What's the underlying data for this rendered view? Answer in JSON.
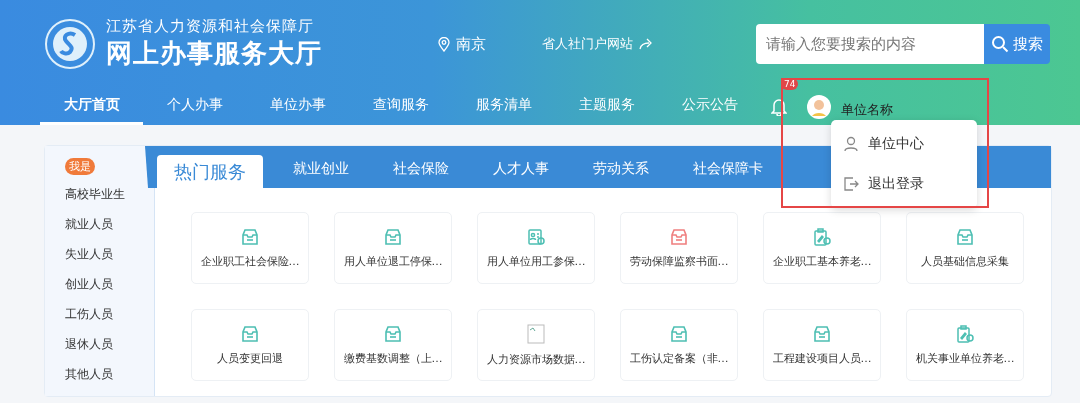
{
  "header": {
    "org_name": "江苏省人力资源和社会保障厅",
    "site_title": "网上办事服务大厅",
    "city": "南京",
    "portal_link": "省人社门户网站",
    "search": {
      "placeholder": "请输入您要搜索的内容",
      "button": "搜索"
    }
  },
  "nav": [
    {
      "label": "大厅首页",
      "selected": true
    },
    {
      "label": "个人办事",
      "selected": false
    },
    {
      "label": "单位办事",
      "selected": false
    },
    {
      "label": "查询服务",
      "selected": false
    },
    {
      "label": "服务清单",
      "selected": false
    },
    {
      "label": "主题服务",
      "selected": false
    },
    {
      "label": "公示公告",
      "selected": false
    }
  ],
  "notifications": {
    "count": "74"
  },
  "user": {
    "name": "单位名称",
    "menu": [
      {
        "kind": "user",
        "label": "单位中心"
      },
      {
        "kind": "logout",
        "label": "退出登录"
      }
    ]
  },
  "sidebar": {
    "badge": "我是",
    "items": [
      "高校毕业生",
      "就业人员",
      "失业人员",
      "创业人员",
      "工伤人员",
      "退休人员",
      "其他人员"
    ]
  },
  "tabs": [
    {
      "label": "热门服务",
      "selected": true
    },
    {
      "label": "就业创业",
      "selected": false
    },
    {
      "label": "社会保险",
      "selected": false
    },
    {
      "label": "人才人事",
      "selected": false
    },
    {
      "label": "劳动关系",
      "selected": false
    },
    {
      "label": "社会保障卡",
      "selected": false
    }
  ],
  "services": [
    {
      "kind": "tray",
      "label": "企业职工社会保险…"
    },
    {
      "kind": "tray",
      "label": "用人单位退工停保…"
    },
    {
      "kind": "certificate",
      "label": "用人单位用工参保…"
    },
    {
      "kind": "alert-tray",
      "label": "劳动保障监察书面…"
    },
    {
      "kind": "clipboard",
      "label": "企业职工基本养老…"
    },
    {
      "kind": "tray",
      "label": "人员基础信息采集"
    },
    {
      "kind": "tray",
      "label": "人员变更回退"
    },
    {
      "kind": "tray",
      "label": "缴费基数调整（上…"
    },
    {
      "kind": "broken-image",
      "label": "人力资源市场数据…"
    },
    {
      "kind": "tray",
      "label": "工伤认定备案（非…"
    },
    {
      "kind": "tray",
      "label": "工程建设项目人员…"
    },
    {
      "kind": "clipboard",
      "label": "机关事业单位养老…"
    }
  ]
}
